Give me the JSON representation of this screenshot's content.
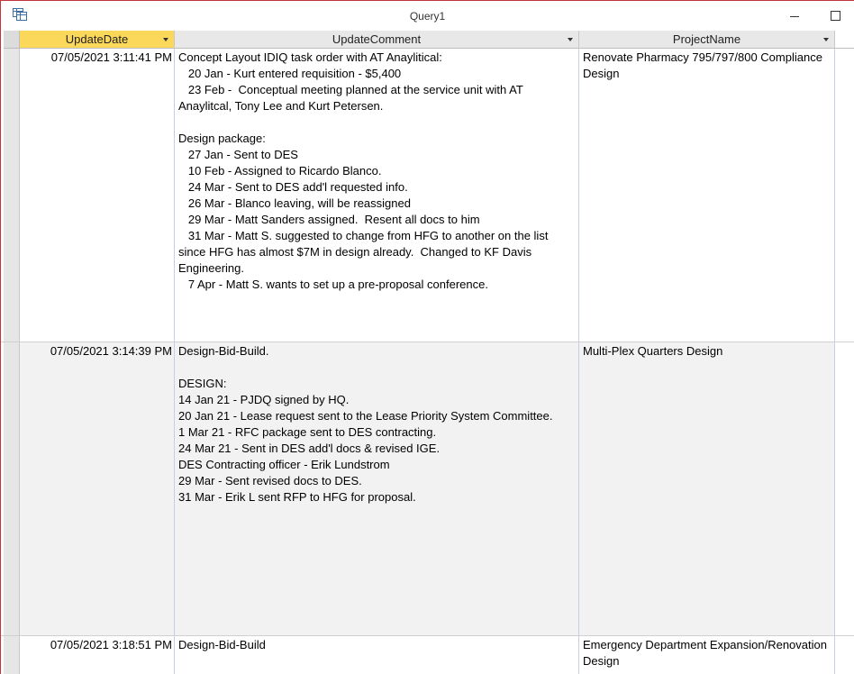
{
  "window": {
    "title": "Query1",
    "icon": "query-datasheet-icon"
  },
  "columns": [
    {
      "name": "UpdateDate"
    },
    {
      "name": "UpdateComment"
    },
    {
      "name": "ProjectName"
    }
  ],
  "rows": [
    {
      "update_date": "07/05/2021 3:11:41 PM",
      "update_comment": "Concept Layout IDIQ task order with AT Anaylitical:\n   20 Jan - Kurt entered requisition - $5,400\n   23 Feb -  Conceptual meeting planned at the service unit with AT Anaylitcal, Tony Lee and Kurt Petersen.\n\nDesign package:\n   27 Jan - Sent to DES\n   10 Feb - Assigned to Ricardo Blanco.\n   24 Mar - Sent to DES add'l requested info.\n   26 Mar - Blanco leaving, will be reassigned\n   29 Mar - Matt Sanders assigned.  Resent all docs to him\n   31 Mar - Matt S. suggested to change from HFG to another on the list since HFG has almost $7M in design already.  Changed to KF Davis Engineering.\n   7 Apr - Matt S. wants to set up a pre-proposal conference.",
      "project_name": "Renovate Pharmacy 795/797/800 Compliance Design"
    },
    {
      "update_date": "07/05/2021 3:14:39 PM",
      "update_comment": "Design-Bid-Build.\n\nDESIGN:\n14 Jan 21 - PJDQ signed by HQ.\n20 Jan 21 - Lease request sent to the Lease Priority System Committee.\n1 Mar 21 - RFC package sent to DES contracting.\n24 Mar 21 - Sent in DES add'l docs & revised IGE.\nDES Contracting officer - Erik Lundstrom\n29 Mar - Sent revised docs to DES.\n31 Mar - Erik L sent RFP to HFG for proposal.",
      "project_name": "Multi-Plex Quarters Design"
    },
    {
      "update_date": "07/05/2021 3:18:51 PM",
      "update_comment": "Design-Bid-Build",
      "project_name": "Emergency Department Expansion/Renovation Design"
    }
  ]
}
